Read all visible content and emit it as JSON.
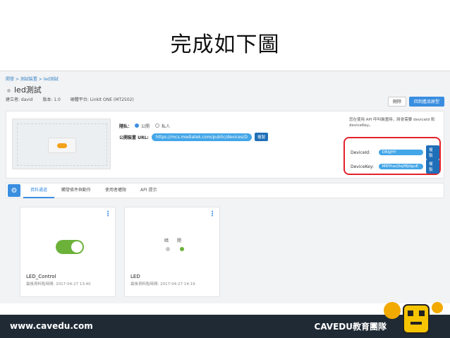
{
  "slide": {
    "title": "完成如下圖",
    "footer_site": "www.cavedu.com",
    "footer_brand": "CAVEDU教育團隊"
  },
  "breadcrumb": "開發 > 測試裝置 > led測試",
  "project": {
    "name": "led測試",
    "meta": [
      "建立者: david",
      "版本: 1.0",
      "硬體平台: LinkIt ONE (MT2502)"
    ]
  },
  "toolbar": {
    "delete_label": "刪除",
    "create_label": "回到產品原型"
  },
  "info": {
    "privacy_label": "隱私：",
    "privacy_options": [
      "公開",
      "私人"
    ],
    "public_url_label": "公開裝置 URL:",
    "public_url": "https://mcs.mediatek.com/public/devices/D",
    "copy_label": "複製",
    "api_note": "您在使用 API 呼叫裝置時，將會需要 deviceId 和 deviceKey。",
    "device_id_label": "DeviceId:",
    "device_id_value": "DBIjjHY",
    "device_key_label": "DeviceKey:",
    "device_key_value": "MRYharj0eJf8JdguE"
  },
  "tabs": [
    "資料通道",
    "觸發條件與動作",
    "使用者權限",
    "API 提示"
  ],
  "cards": [
    {
      "name": "LED_Control",
      "time": "最後資料點時間: 2017-04-27 13:40"
    },
    {
      "name": "LED",
      "time": "最後資料點時間: 2017-04-27 14:19",
      "labels": [
        "暗",
        "開"
      ]
    }
  ]
}
